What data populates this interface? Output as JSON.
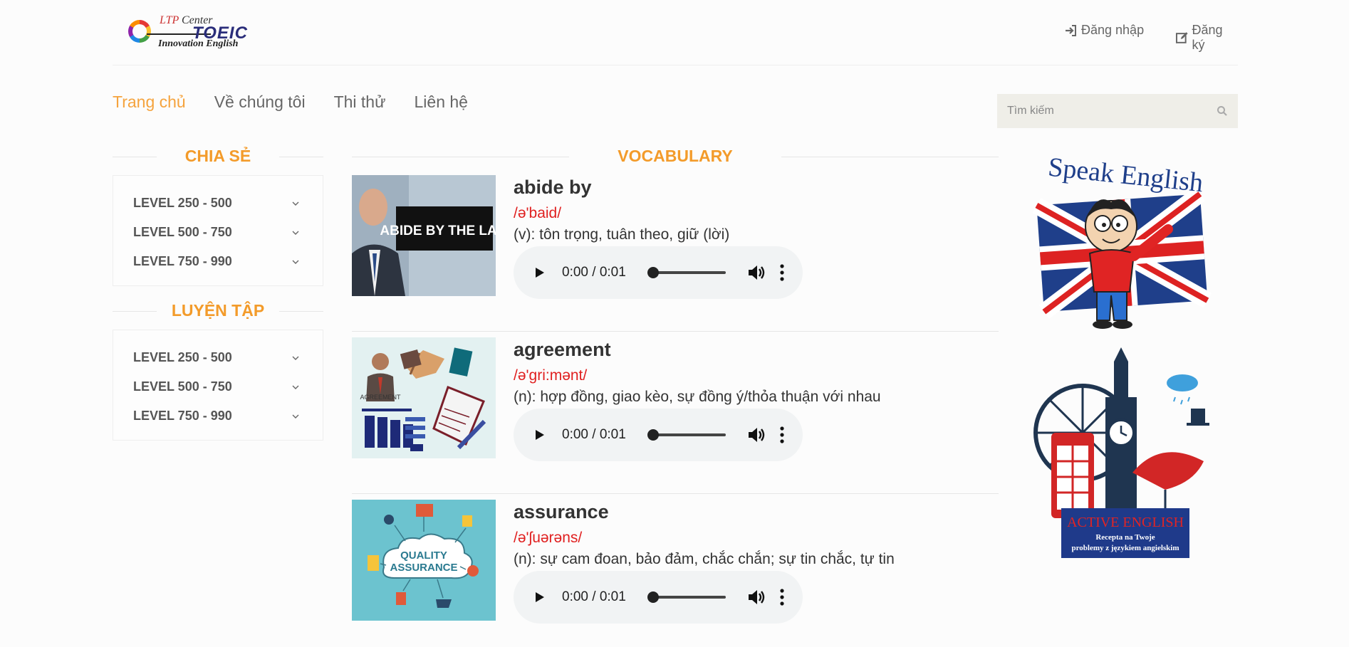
{
  "brand": {
    "line1_a": "LTP",
    "line1_b": "Center",
    "line2": "TOEIC",
    "line3": "Innovation English"
  },
  "auth": {
    "login_label": "Đăng nhập",
    "register_label": "Đăng ký",
    "login_icon": "sign-in-icon",
    "register_icon": "edit-icon"
  },
  "nav": {
    "items": [
      {
        "label": "Trang chủ",
        "active": true
      },
      {
        "label": "Về chúng tôi",
        "active": false
      },
      {
        "label": "Thi thử",
        "active": false
      },
      {
        "label": "Liên hệ",
        "active": false
      }
    ]
  },
  "search": {
    "placeholder": "Tìm kiếm",
    "value": "",
    "icon": "search-icon"
  },
  "sidebar": {
    "share": {
      "title": "CHIA SẺ",
      "levels": [
        "LEVEL 250 - 500",
        "LEVEL 500 - 750",
        "LEVEL 750 - 990"
      ]
    },
    "practice": {
      "title": "LUYỆN TẬP",
      "levels": [
        "LEVEL 250 - 500",
        "LEVEL 500 - 750",
        "LEVEL 750 - 990"
      ]
    }
  },
  "main": {
    "title": "VOCABULARY",
    "entries": [
      {
        "word": "abide by",
        "ipa": "/ə'baid/",
        "meaning": "(v): tôn trọng, tuân theo, giữ (lời)",
        "audio_time": "0:00 / 0:01",
        "image_text": "ABIDE BY THE LAW"
      },
      {
        "word": "agreement",
        "ipa": "/ə'gri:mənt/",
        "meaning": "(n): hợp đồng, giao kèo, sự đồng ý/thỏa thuận với nhau",
        "audio_time": "0:00 / 0:01",
        "image_text": "AGREEMENT"
      },
      {
        "word": "assurance",
        "ipa": "/ə'ʃuərəns/",
        "meaning": "(n): sự cam đoan, bảo đảm, chắc chắn; sự tin chắc, tự tin",
        "audio_time": "0:00 / 0:01",
        "image_text_1": "QUALITY",
        "image_text_2": "ASSURANCE"
      }
    ]
  },
  "banners": {
    "speak": "Speak English",
    "active_title": "ACTIVE ENGLISH",
    "active_sub1": "Recepta na Twoje",
    "active_sub2": "problemy z językiem angielskim"
  },
  "colors": {
    "accent": "#f39b2a",
    "nav_active": "#f5a33d",
    "ipa": "#e02020"
  }
}
